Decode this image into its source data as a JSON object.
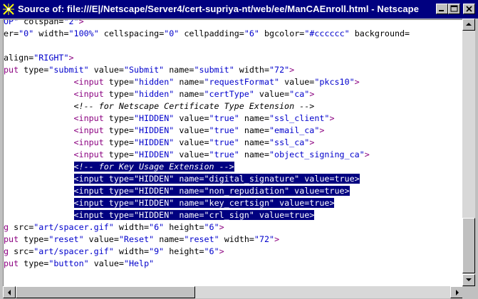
{
  "window": {
    "title": "Source of: file:///E|/Netscape/Server4/cert-supriya-nt/web/ee/ManCAEnroll.html - Netscape"
  },
  "icons": {
    "app": "netscape-source-icon",
    "minimize": "minimize-icon",
    "maximize": "maximize-icon",
    "close": "close-icon",
    "scroll_up": "arrow-up-icon",
    "scroll_down": "arrow-down-icon",
    "scroll_left": "arrow-left-icon",
    "scroll_right": "arrow-right-icon"
  },
  "colors": {
    "titlebar": "#000080",
    "selection": "#000080",
    "tag": "#8b0080",
    "value": "#0000cc",
    "chrome": "#c0c0c0"
  },
  "source": {
    "lines": [
      {
        "selected": false,
        "tokens": [
          {
            "c": "s",
            "t": "OP\""
          },
          {
            "c": "t",
            "t": " colspan="
          },
          {
            "c": "s",
            "t": "\"2\""
          },
          {
            "c": "k",
            "t": ">"
          }
        ]
      },
      {
        "selected": false,
        "tokens": [
          {
            "c": "t",
            "t": "er="
          },
          {
            "c": "s",
            "t": "\"0\""
          },
          {
            "c": "t",
            "t": " width="
          },
          {
            "c": "s",
            "t": "\"100%\""
          },
          {
            "c": "t",
            "t": " cellspacing="
          },
          {
            "c": "s",
            "t": "\"0\""
          },
          {
            "c": "t",
            "t": " cellpadding="
          },
          {
            "c": "s",
            "t": "\"6\""
          },
          {
            "c": "t",
            "t": " bgcolor="
          },
          {
            "c": "s",
            "t": "\"#cccccc\""
          },
          {
            "c": "t",
            "t": " background="
          }
        ]
      },
      {
        "selected": false,
        "tokens": []
      },
      {
        "selected": false,
        "tokens": [
          {
            "c": "t",
            "t": "align="
          },
          {
            "c": "s",
            "t": "\"RIGHT\""
          },
          {
            "c": "k",
            "t": ">"
          }
        ]
      },
      {
        "selected": false,
        "tokens": [
          {
            "c": "k",
            "t": "put"
          },
          {
            "c": "t",
            "t": " type="
          },
          {
            "c": "s",
            "t": "\"submit\""
          },
          {
            "c": "t",
            "t": " value="
          },
          {
            "c": "s",
            "t": "\"Submit\""
          },
          {
            "c": "t",
            "t": " name="
          },
          {
            "c": "s",
            "t": "\"submit\""
          },
          {
            "c": "t",
            "t": " width="
          },
          {
            "c": "s",
            "t": "\"72\""
          },
          {
            "c": "k",
            "t": ">"
          }
        ]
      },
      {
        "selected": false,
        "tokens": [
          {
            "c": "t",
            "t": "              "
          },
          {
            "c": "k",
            "t": "<input"
          },
          {
            "c": "t",
            "t": " type="
          },
          {
            "c": "s",
            "t": "\"hidden\""
          },
          {
            "c": "t",
            "t": " name="
          },
          {
            "c": "s",
            "t": "\"requestFormat\""
          },
          {
            "c": "t",
            "t": " value="
          },
          {
            "c": "s",
            "t": "\"pkcs10\""
          },
          {
            "c": "k",
            "t": ">"
          }
        ]
      },
      {
        "selected": false,
        "tokens": [
          {
            "c": "t",
            "t": "              "
          },
          {
            "c": "k",
            "t": "<input"
          },
          {
            "c": "t",
            "t": " type="
          },
          {
            "c": "s",
            "t": "\"hidden\""
          },
          {
            "c": "t",
            "t": " name="
          },
          {
            "c": "s",
            "t": "\"certType\""
          },
          {
            "c": "t",
            "t": " value="
          },
          {
            "c": "s",
            "t": "\"ca\""
          },
          {
            "c": "k",
            "t": ">"
          }
        ]
      },
      {
        "selected": false,
        "tokens": [
          {
            "c": "t",
            "t": "              "
          },
          {
            "c": "c",
            "t": "<!-- for Netscape Certificate Type Extension -->"
          }
        ]
      },
      {
        "selected": false,
        "tokens": [
          {
            "c": "t",
            "t": "              "
          },
          {
            "c": "k",
            "t": "<input"
          },
          {
            "c": "t",
            "t": " type="
          },
          {
            "c": "s",
            "t": "\"HIDDEN\""
          },
          {
            "c": "t",
            "t": " value="
          },
          {
            "c": "s",
            "t": "\"true\""
          },
          {
            "c": "t",
            "t": " name="
          },
          {
            "c": "s",
            "t": "\"ssl_client\""
          },
          {
            "c": "k",
            "t": ">"
          }
        ]
      },
      {
        "selected": false,
        "tokens": [
          {
            "c": "t",
            "t": "              "
          },
          {
            "c": "k",
            "t": "<input"
          },
          {
            "c": "t",
            "t": " type="
          },
          {
            "c": "s",
            "t": "\"HIDDEN\""
          },
          {
            "c": "t",
            "t": " value="
          },
          {
            "c": "s",
            "t": "\"true\""
          },
          {
            "c": "t",
            "t": " name="
          },
          {
            "c": "s",
            "t": "\"email_ca\""
          },
          {
            "c": "k",
            "t": ">"
          }
        ]
      },
      {
        "selected": false,
        "tokens": [
          {
            "c": "t",
            "t": "              "
          },
          {
            "c": "k",
            "t": "<input"
          },
          {
            "c": "t",
            "t": " type="
          },
          {
            "c": "s",
            "t": "\"HIDDEN\""
          },
          {
            "c": "t",
            "t": " value="
          },
          {
            "c": "s",
            "t": "\"true\""
          },
          {
            "c": "t",
            "t": " name="
          },
          {
            "c": "s",
            "t": "\"ssl_ca\""
          },
          {
            "c": "k",
            "t": ">"
          }
        ]
      },
      {
        "selected": false,
        "tokens": [
          {
            "c": "t",
            "t": "              "
          },
          {
            "c": "k",
            "t": "<input"
          },
          {
            "c": "t",
            "t": " type="
          },
          {
            "c": "s",
            "t": "\"HIDDEN\""
          },
          {
            "c": "t",
            "t": " value="
          },
          {
            "c": "s",
            "t": "\"true\""
          },
          {
            "c": "t",
            "t": " name="
          },
          {
            "c": "s",
            "t": "\"object_signing_ca\""
          },
          {
            "c": "k",
            "t": ">"
          }
        ]
      },
      {
        "selected": "partial",
        "tokens": [
          {
            "c": "t",
            "t": "              "
          },
          {
            "c": "c",
            "t": "<!-- for Key Usage Extension -->",
            "sel": true
          }
        ]
      },
      {
        "selected": true,
        "tokens": [
          {
            "c": "t",
            "t": "              "
          },
          {
            "c": "k",
            "t": "<input"
          },
          {
            "c": "t",
            "t": " type="
          },
          {
            "c": "s",
            "t": "\"HIDDEN\""
          },
          {
            "c": "t",
            "t": " name="
          },
          {
            "c": "s",
            "t": "\"digital_signature\""
          },
          {
            "c": "t",
            "t": " value=true"
          },
          {
            "c": "k",
            "t": ">"
          }
        ]
      },
      {
        "selected": true,
        "tokens": [
          {
            "c": "t",
            "t": "              "
          },
          {
            "c": "k",
            "t": "<input"
          },
          {
            "c": "t",
            "t": " type="
          },
          {
            "c": "s",
            "t": "\"HIDDEN\""
          },
          {
            "c": "t",
            "t": " name="
          },
          {
            "c": "s",
            "t": "\"non_repudiation\""
          },
          {
            "c": "t",
            "t": " value=true"
          },
          {
            "c": "k",
            "t": ">"
          }
        ]
      },
      {
        "selected": true,
        "tokens": [
          {
            "c": "t",
            "t": "              "
          },
          {
            "c": "k",
            "t": "<input"
          },
          {
            "c": "t",
            "t": " type="
          },
          {
            "c": "s",
            "t": "\"HIDDEN\""
          },
          {
            "c": "t",
            "t": " name="
          },
          {
            "c": "s",
            "t": "\"key_certsign\""
          },
          {
            "c": "t",
            "t": " value=true"
          },
          {
            "c": "k",
            "t": ">"
          }
        ]
      },
      {
        "selected": true,
        "tokens": [
          {
            "c": "t",
            "t": "              "
          },
          {
            "c": "k",
            "t": "<input"
          },
          {
            "c": "t",
            "t": " type="
          },
          {
            "c": "s",
            "t": "\"HIDDEN\""
          },
          {
            "c": "t",
            "t": " name="
          },
          {
            "c": "s",
            "t": "\"crl_sign\""
          },
          {
            "c": "t",
            "t": " value=true"
          },
          {
            "c": "k",
            "t": ">"
          }
        ]
      },
      {
        "selected": false,
        "tokens": [
          {
            "c": "k",
            "t": "g"
          },
          {
            "c": "t",
            "t": " src="
          },
          {
            "c": "s",
            "t": "\"art/spacer.gif\""
          },
          {
            "c": "t",
            "t": " width="
          },
          {
            "c": "s",
            "t": "\"6\""
          },
          {
            "c": "t",
            "t": " height="
          },
          {
            "c": "s",
            "t": "\"6\""
          },
          {
            "c": "k",
            "t": ">"
          }
        ]
      },
      {
        "selected": false,
        "tokens": [
          {
            "c": "k",
            "t": "put"
          },
          {
            "c": "t",
            "t": " type="
          },
          {
            "c": "s",
            "t": "\"reset\""
          },
          {
            "c": "t",
            "t": " value="
          },
          {
            "c": "s",
            "t": "\"Reset\""
          },
          {
            "c": "t",
            "t": " name="
          },
          {
            "c": "s",
            "t": "\"reset\""
          },
          {
            "c": "t",
            "t": " width="
          },
          {
            "c": "s",
            "t": "\"72\""
          },
          {
            "c": "k",
            "t": ">"
          }
        ]
      },
      {
        "selected": false,
        "tokens": [
          {
            "c": "k",
            "t": "g"
          },
          {
            "c": "t",
            "t": " src="
          },
          {
            "c": "s",
            "t": "\"art/spacer.gif\""
          },
          {
            "c": "t",
            "t": " width="
          },
          {
            "c": "s",
            "t": "\"9\""
          },
          {
            "c": "t",
            "t": " height="
          },
          {
            "c": "s",
            "t": "\"6\""
          },
          {
            "c": "k",
            "t": ">"
          }
        ]
      },
      {
        "selected": false,
        "tokens": [
          {
            "c": "k",
            "t": "put"
          },
          {
            "c": "t",
            "t": " type="
          },
          {
            "c": "s",
            "t": "\"button\""
          },
          {
            "c": "t",
            "t": " value="
          },
          {
            "c": "s",
            "t": "\"Help\""
          }
        ]
      }
    ]
  }
}
